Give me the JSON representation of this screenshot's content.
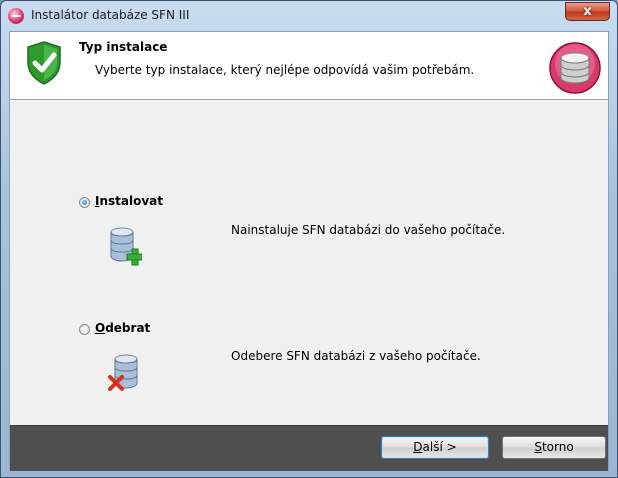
{
  "window": {
    "title": "Instalátor databáze SFN III",
    "close_label": "x"
  },
  "header": {
    "title": "Typ instalace",
    "subtitle": "Vyberte typ instalace, který nejlépe odpovídá vašim potřebám."
  },
  "options": [
    {
      "label_accel": "I",
      "label_rest": "nstalovat",
      "description": "Nainstaluje SFN databázi do vašeho počítače.",
      "selected": true,
      "icon": "database-add-icon"
    },
    {
      "label_accel": "O",
      "label_rest": "debrat",
      "description": "Odebere SFN databázi z vašeho počítače.",
      "selected": false,
      "icon": "database-remove-icon"
    }
  ],
  "footer": {
    "next_accel": "D",
    "next_rest": "alší >",
    "cancel_accel": "S",
    "cancel_rest": "torno"
  },
  "colors": {
    "footer_bg": "#4f4f4f",
    "shield_green": "#2e9a2e",
    "logo_pink": "#d93a6c"
  }
}
